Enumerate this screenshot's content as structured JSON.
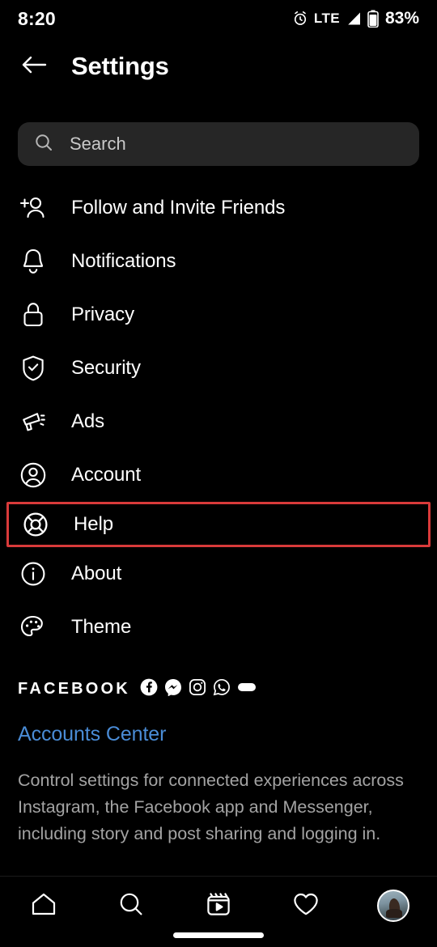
{
  "status_bar": {
    "time": "8:20",
    "alarm_icon": "alarm-clock-icon",
    "network": "LTE",
    "signal_icon": "signal-bars-icon",
    "battery_icon": "battery-icon",
    "battery_percent": "83%"
  },
  "header": {
    "back_icon": "back-arrow-icon",
    "title": "Settings"
  },
  "search": {
    "icon": "search-icon",
    "placeholder": "Search",
    "value": ""
  },
  "settings_list": [
    {
      "label": "Follow and Invite Friends",
      "icon": "person-add-icon",
      "highlighted": false
    },
    {
      "label": "Notifications",
      "icon": "bell-icon",
      "highlighted": false
    },
    {
      "label": "Privacy",
      "icon": "lock-icon",
      "highlighted": false
    },
    {
      "label": "Security",
      "icon": "shield-check-icon",
      "highlighted": false
    },
    {
      "label": "Ads",
      "icon": "megaphone-icon",
      "highlighted": false
    },
    {
      "label": "Account",
      "icon": "user-circle-icon",
      "highlighted": false
    },
    {
      "label": "Help",
      "icon": "life-ring-icon",
      "highlighted": true
    },
    {
      "label": "About",
      "icon": "info-circle-icon",
      "highlighted": false
    },
    {
      "label": "Theme",
      "icon": "palette-icon",
      "highlighted": false
    }
  ],
  "facebook_section": {
    "brand": "FACEBOOK",
    "app_icons": [
      "facebook-icon",
      "messenger-icon",
      "instagram-icon",
      "whatsapp-icon",
      "portal-icon"
    ],
    "accounts_center_link": "Accounts Center",
    "description": "Control settings for connected experiences across Instagram, the Facebook app and Messenger, including story and post sharing and logging in."
  },
  "bottom_nav": [
    {
      "icon": "home-icon"
    },
    {
      "icon": "search-icon"
    },
    {
      "icon": "reels-icon"
    },
    {
      "icon": "heart-icon"
    },
    {
      "icon": "profile-avatar-icon"
    }
  ],
  "colors": {
    "background": "#000000",
    "highlight_border": "#d93a3a",
    "link_blue": "#4a8cd6",
    "secondary_text": "#a3a3a3",
    "search_field": "#262626"
  }
}
